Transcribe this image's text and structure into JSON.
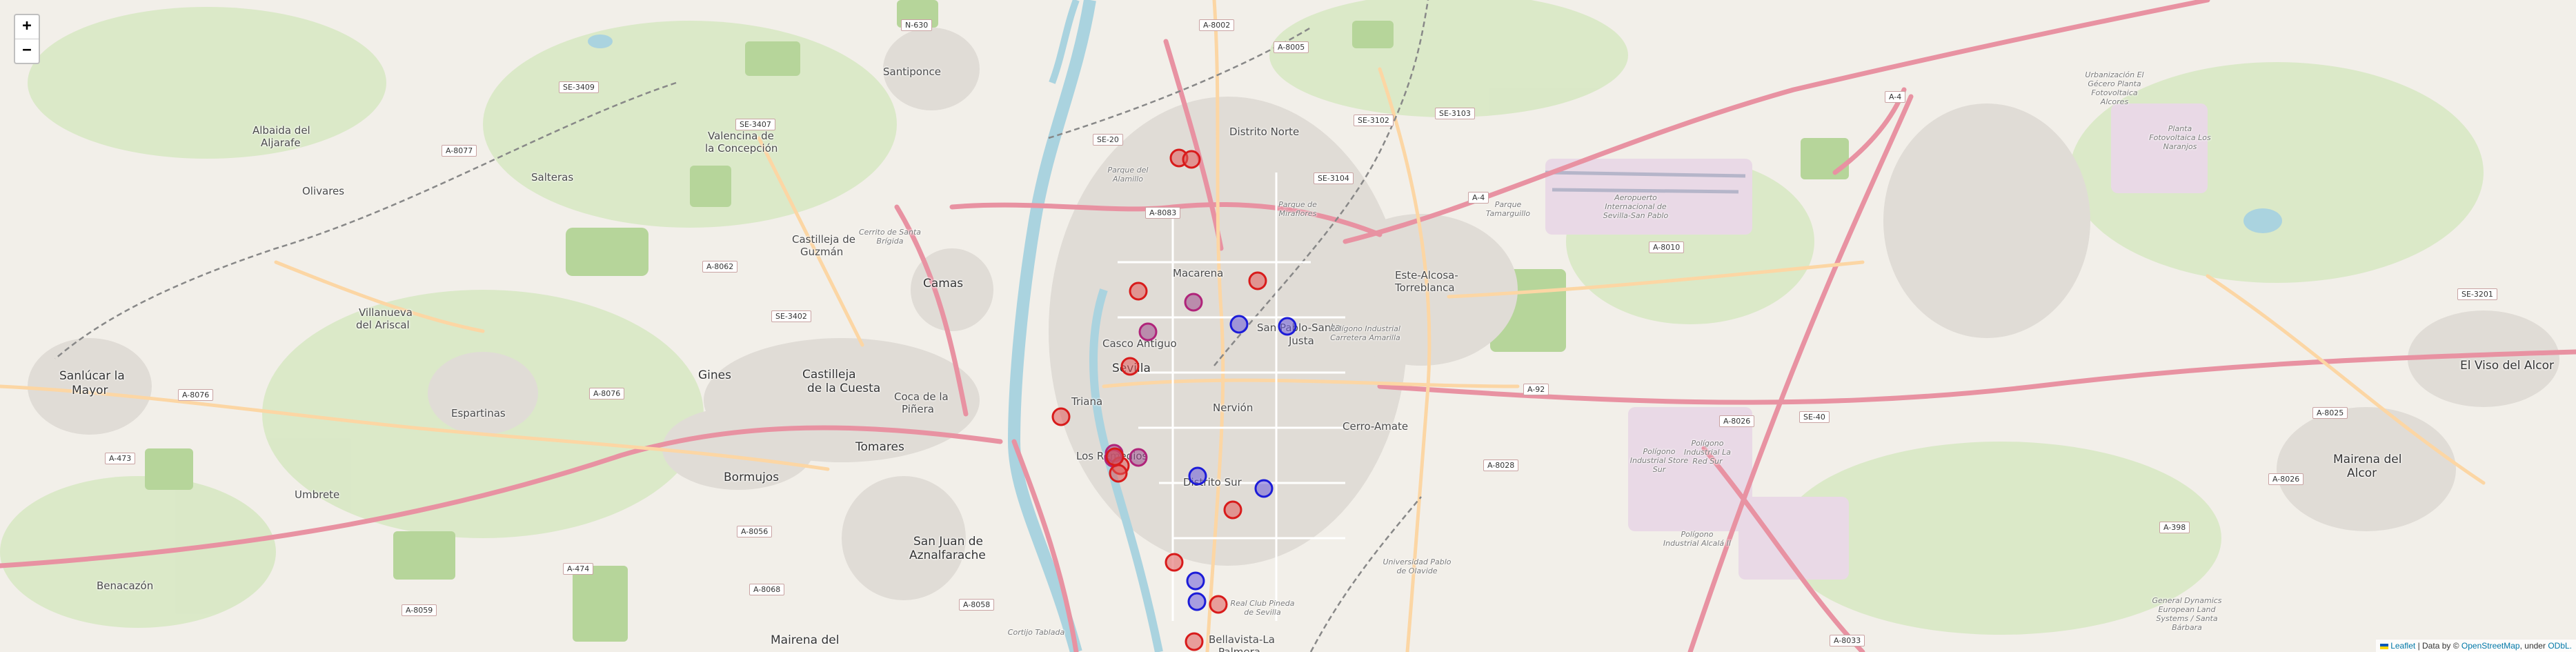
{
  "controls": {
    "zoom_in": "+",
    "zoom_out": "−"
  },
  "attribution": {
    "leaflet": "Leaflet",
    "sep1": " | Data by © ",
    "osm": "OpenStreetMap",
    "sep2": ", under ",
    "license": "ODbL."
  },
  "places": {
    "sevilla": "Sevilla",
    "triana": "Triana",
    "macarena": "Macarena",
    "casco_antiguo": "Casco Antiguo",
    "nervion": "Nervión",
    "san_pablo_santa_justa_1": "San Pablo-Santa",
    "san_pablo_santa_justa_2": "Justa",
    "cerro_amate": "Cerro-Amate",
    "distrito_sur": "Distrito Sur",
    "los_remedios": "Los Remedios",
    "bellavista_1": "Bellavista-La",
    "bellavista_2": "Palmera",
    "distrito_norte": "Distrito Norte",
    "este_1": "Este-Alcosa-",
    "este_2": "Torreblanca",
    "camas": "Camas",
    "tomares": "Tomares",
    "bormujos": "Bormujos",
    "gines": "Gines",
    "espartinas": "Espartinas",
    "castilleja_cuesta_1": "Castilleja",
    "castilleja_cuesta_2": "de la Cuesta",
    "coca_pinera_1": "Coca de la",
    "coca_pinera_2": "Piñera",
    "san_juan_1": "San Juan de",
    "san_juan_2": "Aznalfarache",
    "mairena_aljarafe": "Mairena del",
    "santiponce": "Santiponce",
    "valencina_1": "Valencina de",
    "valencina_2": "la Concepción",
    "castilleja_guzman_1": "Castilleja de",
    "castilleja_guzman_2": "Guzmán",
    "salteras": "Salteras",
    "olivares": "Olivares",
    "albaida_1": "Albaida del",
    "albaida_2": "Aljarafe",
    "villanueva_1": "Villanueva",
    "villanueva_2": "del Ariscal",
    "sanlucar_1": "Sanlúcar la",
    "sanlucar_2": "Mayor",
    "umbrete": "Umbrete",
    "benacazon": "Benacazón",
    "el_viso_1": "El Viso del Alcor",
    "mairena_alcor_1": "Mairena del",
    "mairena_alcor_2": "Alcor"
  },
  "pois": {
    "aeropuerto": "Aeropuerto Internacional de Sevilla-San Pablo",
    "parque_tamarguillo": "Parque Tamarguillo",
    "parque_miraflores": "Parque de Miraflores",
    "parque_alamillo": "Parque del Alamillo",
    "poligono_carretera": "Polígono Industrial Carretera Amarilla",
    "poligono_store": "Polígono Industrial Store Sur",
    "poligono_red": "Polígono Industrial La Red Sur",
    "poligono_alcala": "Polígono Industrial Alcalá II",
    "universidad": "Universidad Pablo de Olavide",
    "real_club": "Real Club Pineda de Sevilla",
    "urbanizacion": "Urbanización El Gécero Planta Fotovoltaica Alcores",
    "planta_solar": "Planta Fotovoltaica Los Naranjos",
    "general_dynamics": "General Dynamics European Land Systems / Santa Bárbara",
    "cerrito": "Cerrito de Santa Brígida",
    "cortijo": "Cortijo Tablada"
  },
  "road_shields": {
    "n630": "N-630",
    "a8002": "A-8002",
    "a8005": "A-8005",
    "se3409": "SE-3409",
    "se3407": "SE-3407",
    "a8077": "A-8077",
    "se20": "SE-20",
    "a8083": "A-8083",
    "se3102": "SE-3102",
    "se3103": "SE-3103",
    "se3104": "SE-3104",
    "a4": "A-4",
    "a4b": "A-4",
    "a8062": "A-8062",
    "se3402": "SE-3402",
    "a8076": "A-8076",
    "a8076b": "A-8076",
    "a473": "A-473",
    "a8010": "A-8010",
    "a92": "A-92",
    "a8026": "A-8026",
    "a8028": "A-8028",
    "se40": "SE-40",
    "se3201": "SE-3201",
    "a8025": "A-8025",
    "a8026b": "A-8026",
    "a398": "A-398",
    "a474": "A-474",
    "a8056": "A-8056",
    "a8068": "A-8068",
    "a8058": "A-8058",
    "a8059": "A-8059",
    "a8033": "A-8033"
  },
  "markers": [
    {
      "color": "red"
    },
    {
      "color": "red"
    },
    {
      "color": "red"
    },
    {
      "color": "purple"
    },
    {
      "color": "purple"
    },
    {
      "color": "red"
    },
    {
      "color": "purple"
    },
    {
      "color": "blue"
    },
    {
      "color": "blue"
    },
    {
      "color": "blue"
    },
    {
      "color": "red"
    },
    {
      "color": "red"
    },
    {
      "color": "red"
    },
    {
      "color": "purple"
    },
    {
      "color": "purple"
    },
    {
      "color": "red"
    },
    {
      "color": "red"
    },
    {
      "color": "blue"
    },
    {
      "color": "blue"
    },
    {
      "color": "red"
    },
    {
      "color": "red"
    },
    {
      "color": "blue"
    },
    {
      "color": "red"
    },
    {
      "color": "red"
    }
  ],
  "marker_colors": {
    "red": {
      "fill": "#e05a5a",
      "stroke": "#d81b1b"
    },
    "purple": {
      "fill": "#9a4a8a",
      "stroke": "#b0247a"
    },
    "blue": {
      "fill": "#6a5ad8",
      "stroke": "#1c1cd8"
    }
  }
}
